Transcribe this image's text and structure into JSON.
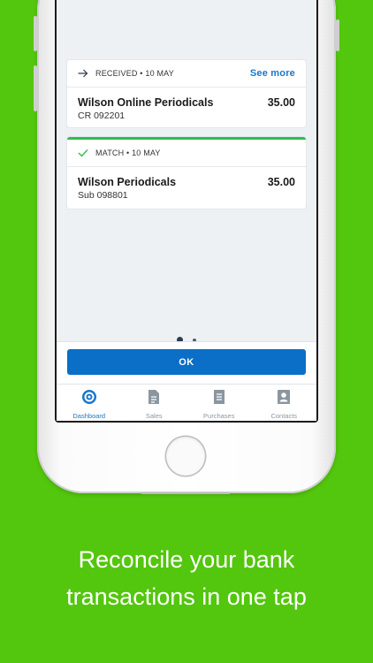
{
  "received_card": {
    "header": "RECEIVED • 10 MAY",
    "see_more": "See more",
    "title": "Wilson Online Periodicals",
    "reference": "CR 092201",
    "amount": "35.00"
  },
  "match_card": {
    "header": "MATCH • 10 MAY",
    "title": "Wilson Periodicals",
    "reference": "Sub 098801",
    "amount": "35.00"
  },
  "pager": {
    "total": 2,
    "active": 1
  },
  "ok_label": "OK",
  "tabs": [
    {
      "label": "Dashboard",
      "icon": "dashboard-icon",
      "active": true
    },
    {
      "label": "Sales",
      "icon": "sales-icon",
      "active": false
    },
    {
      "label": "Purchases",
      "icon": "purchases-icon",
      "active": false
    },
    {
      "label": "Contacts",
      "icon": "contacts-icon",
      "active": false
    }
  ],
  "caption": {
    "line1": "Reconcile your bank",
    "line2": "transactions in one tap"
  },
  "colors": {
    "background": "#53c60e",
    "accent": "#1976c9",
    "ok_button": "#0b6ec7",
    "match_bar": "#2dbd4e"
  }
}
